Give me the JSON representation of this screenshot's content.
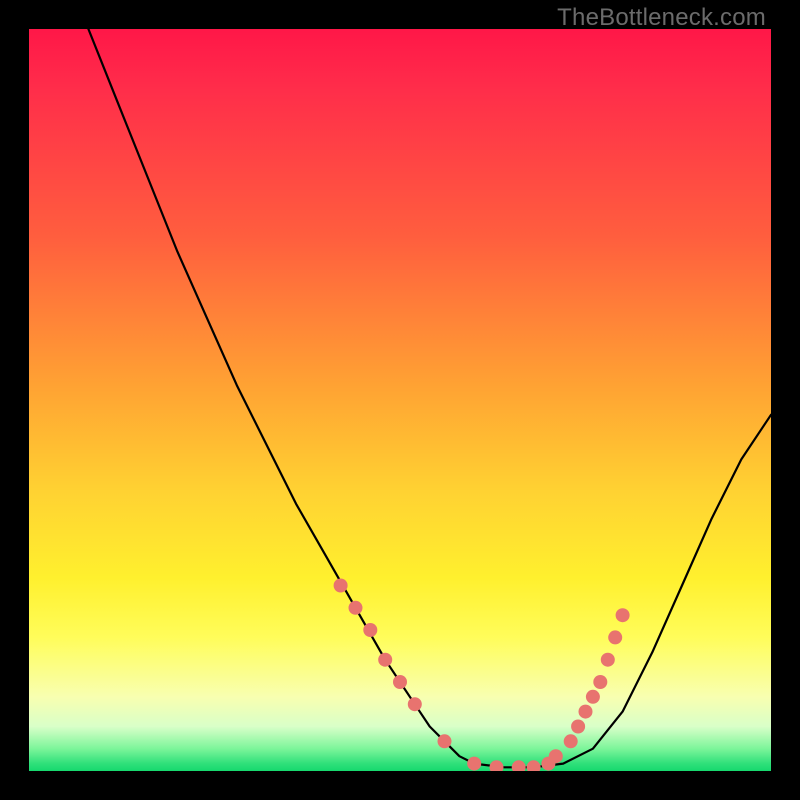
{
  "watermark": "TheBottleneck.com",
  "chart_data": {
    "type": "line",
    "title": "",
    "xlabel": "",
    "ylabel": "",
    "xlim": [
      0,
      100
    ],
    "ylim": [
      0,
      100
    ],
    "grid": false,
    "series": [
      {
        "name": "curve",
        "color": "#000000",
        "x": [
          8,
          12,
          16,
          20,
          24,
          28,
          32,
          36,
          40,
          44,
          48,
          50,
          52,
          54,
          56,
          58,
          60,
          64,
          68,
          72,
          76,
          80,
          84,
          88,
          92,
          96,
          100
        ],
        "values": [
          100,
          90,
          80,
          70,
          61,
          52,
          44,
          36,
          29,
          22,
          15,
          12,
          9,
          6,
          4,
          2,
          1,
          0.5,
          0.5,
          1,
          3,
          8,
          16,
          25,
          34,
          42,
          48
        ]
      }
    ],
    "markers": {
      "name": "dots",
      "color": "#e8736f",
      "radius_px": 7,
      "x": [
        42,
        44,
        46,
        48,
        50,
        52,
        56,
        60,
        63,
        66,
        68,
        70,
        71,
        73,
        74,
        75,
        76,
        77,
        78,
        79,
        80
      ],
      "values": [
        25,
        22,
        19,
        15,
        12,
        9,
        4,
        1,
        0.5,
        0.5,
        0.5,
        1,
        2,
        4,
        6,
        8,
        10,
        12,
        15,
        18,
        21
      ]
    }
  }
}
